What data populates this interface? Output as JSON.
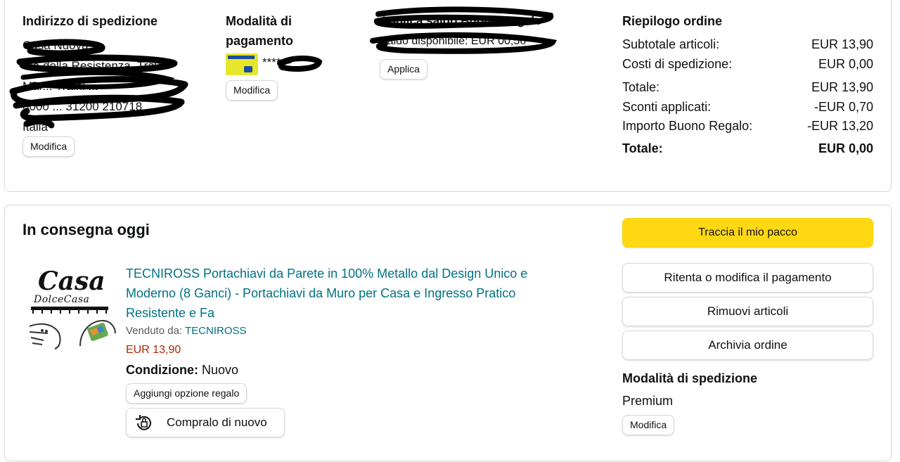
{
  "shipping": {
    "title": "Indirizzo di spedizione",
    "lines": [
      "Casa Nuova",
      "Via della Resistenza, Trav.",
      "Mar... Traini ...",
      "0000 ... 31200 210718",
      "Italia"
    ],
    "edit_label": "Modifica"
  },
  "payment": {
    "title_line1": "Modalità di",
    "title_line2": "pagamento",
    "card_masked": "****",
    "edit_label": "Modifica"
  },
  "gift_card": {
    "title": "Applica saldo Buono Regalo",
    "subtitle": "Saldo disponibile: EUR 00,56",
    "apply_label": "Applica"
  },
  "summary": {
    "title": "Riepilogo ordine",
    "rows": [
      {
        "label": "Subtotale articoli:",
        "value": "EUR 13,90"
      },
      {
        "label": "Costi di spedizione:",
        "value": "EUR 0,00"
      },
      {
        "label": "Totale:",
        "value": "EUR 13,90"
      },
      {
        "label": "Sconti applicati:",
        "value": "-EUR 0,70"
      },
      {
        "label": "Importo Buono Regalo:",
        "value": "-EUR 13,20"
      }
    ],
    "total_label": "Totale:",
    "total_value": "EUR 0,00"
  },
  "delivery": {
    "status": "In consegna oggi",
    "product": {
      "title": "TECNIROSS Portachiavi da Parete in 100% Metallo dal Design Unico e Moderno (8 Ganci) - Portachiavi da Muro per Casa e Ingresso Pratico Resistente e Fa",
      "seller_label": "Venduto da:",
      "seller_name": "TECNIROSS",
      "price": "EUR 13,90",
      "condition_label": "Condizione:",
      "condition_value": "Nuovo",
      "gift_option_label": "Aggiungi opzione regalo",
      "buy_again_label": "Compralo di nuovo",
      "image_text_line1": "Casa",
      "image_text_line2": "DolceCasa"
    },
    "actions": {
      "track": "Traccia il mio pacco",
      "retry_payment": "Ritenta o modifica il pagamento",
      "remove_items": "Rimuovi articoli",
      "archive_order": "Archivia ordine"
    },
    "shipping_method": {
      "title": "Modalità di spedizione",
      "value": "Premium",
      "edit_label": "Modifica"
    }
  },
  "colors": {
    "accent_yellow": "#ffd814",
    "link_teal": "#007185",
    "price_red": "#b12704",
    "border": "#d5d9d9"
  },
  "icons": [
    "card-logo-icon",
    "buy-again-icon"
  ]
}
